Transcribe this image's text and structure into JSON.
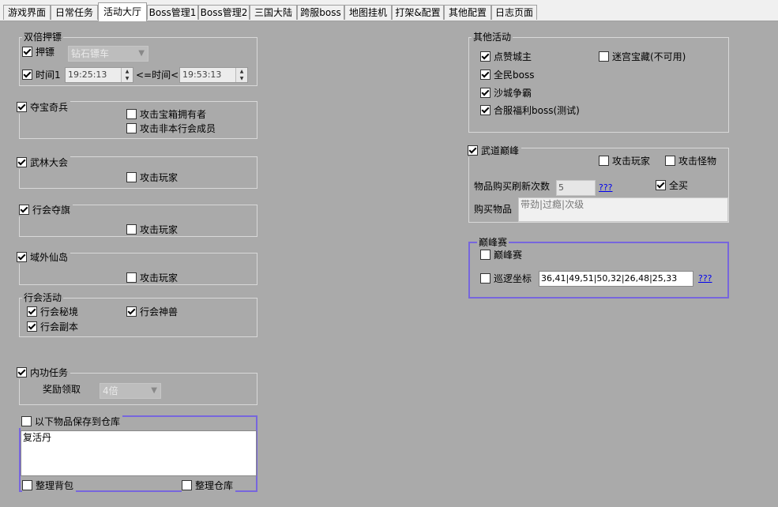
{
  "tabs": [
    {
      "label": "游戏界面"
    },
    {
      "label": "日常任务"
    },
    {
      "label": "活动大厅"
    },
    {
      "label": "Boss管理1"
    },
    {
      "label": "Boss管理2"
    },
    {
      "label": "三国大陆"
    },
    {
      "label": "跨服boss"
    },
    {
      "label": "地图挂机"
    },
    {
      "label": "打架&配置"
    },
    {
      "label": "其他配置"
    },
    {
      "label": "日志页面"
    }
  ],
  "active_tab": "活动大厅",
  "double_escort": {
    "title": "双倍押镖",
    "escort": {
      "label": "押镖",
      "checked": true
    },
    "escort_select": "钻石镖车",
    "time": {
      "label": "时间1",
      "checked": true
    },
    "time_start": "19:25:13",
    "time_sep": "<=时间<=",
    "time_end": "19:53:13"
  },
  "treasure": {
    "main": {
      "label": "夺宝奇兵",
      "checked": true
    },
    "attack_owner": {
      "label": "攻击宝箱拥有者",
      "checked": false
    },
    "attack_non_guild": {
      "label": "攻击非本行会成员",
      "checked": false
    }
  },
  "wulin": {
    "main": {
      "label": "武林大会",
      "checked": true
    },
    "attack": {
      "label": "攻击玩家",
      "checked": false
    }
  },
  "guild_flag": {
    "main": {
      "label": "行会夺旗",
      "checked": true
    },
    "attack": {
      "label": "攻击玩家",
      "checked": false
    }
  },
  "island": {
    "main": {
      "label": "域外仙岛",
      "checked": true
    },
    "attack": {
      "label": "攻击玩家",
      "checked": false
    }
  },
  "guild_activity": {
    "title": "行会活动",
    "secret": {
      "label": "行会秘境",
      "checked": true
    },
    "beast": {
      "label": "行会神兽",
      "checked": true
    },
    "dungeon": {
      "label": "行会副本",
      "checked": true
    }
  },
  "inner": {
    "main": {
      "label": "内功任务",
      "checked": true
    },
    "reward_label": "奖励领取",
    "reward_select": "4倍"
  },
  "warehouse": {
    "main": {
      "label": "以下物品保存到仓库",
      "checked": false
    },
    "items": "复活丹",
    "sort_bag": {
      "label": "整理背包",
      "checked": false
    },
    "sort_wh": {
      "label": "整理仓库",
      "checked": false
    }
  },
  "other": {
    "title": "其他活动",
    "like": {
      "label": "点赞城主",
      "checked": true
    },
    "maze": {
      "label": "迷宫宝藏(不可用)",
      "checked": false
    },
    "allboss": {
      "label": "全民boss",
      "checked": true
    },
    "sand": {
      "label": "沙城争霸",
      "checked": true
    },
    "merge": {
      "label": "合服福利boss(测试)",
      "checked": true
    }
  },
  "wudao": {
    "main": {
      "label": "武道巅峰",
      "checked": true
    },
    "attack_player": {
      "label": "攻击玩家",
      "checked": false
    },
    "attack_monster": {
      "label": "攻击怪物",
      "checked": false
    },
    "refresh_label": "物品购买刷新次数",
    "refresh_value": "5",
    "help": "???",
    "buy_all": {
      "label": "全买",
      "checked": true
    },
    "buy_label": "购买物品",
    "buy_items": "带劲|过瘾|次级"
  },
  "peak": {
    "title": "巅峰赛",
    "main": {
      "label": "巅峰赛",
      "checked": false
    },
    "patrol": {
      "label": "巡逻坐标",
      "checked": false
    },
    "coords": "36,41|49,51|50,32|26,48|25,33",
    "help": "???"
  }
}
